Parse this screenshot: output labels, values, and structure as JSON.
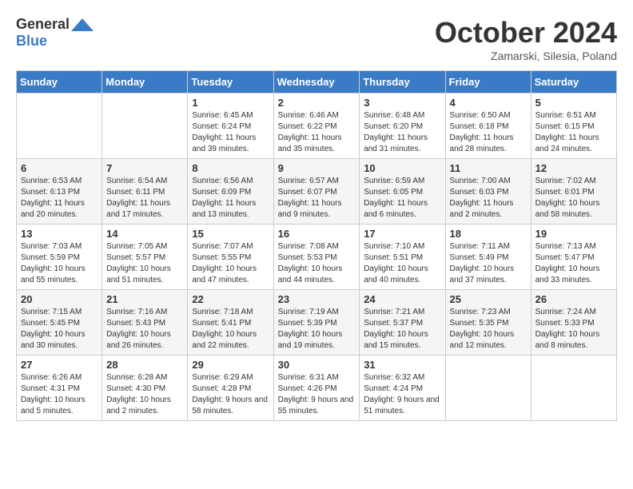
{
  "logo": {
    "general": "General",
    "blue": "Blue"
  },
  "title": "October 2024",
  "location": "Zamarski, Silesia, Poland",
  "days_of_week": [
    "Sunday",
    "Monday",
    "Tuesday",
    "Wednesday",
    "Thursday",
    "Friday",
    "Saturday"
  ],
  "weeks": [
    [
      {
        "day": "",
        "info": ""
      },
      {
        "day": "",
        "info": ""
      },
      {
        "day": "1",
        "info": "Sunrise: 6:45 AM\nSunset: 6:24 PM\nDaylight: 11 hours and 39 minutes."
      },
      {
        "day": "2",
        "info": "Sunrise: 6:46 AM\nSunset: 6:22 PM\nDaylight: 11 hours and 35 minutes."
      },
      {
        "day": "3",
        "info": "Sunrise: 6:48 AM\nSunset: 6:20 PM\nDaylight: 11 hours and 31 minutes."
      },
      {
        "day": "4",
        "info": "Sunrise: 6:50 AM\nSunset: 6:18 PM\nDaylight: 11 hours and 28 minutes."
      },
      {
        "day": "5",
        "info": "Sunrise: 6:51 AM\nSunset: 6:15 PM\nDaylight: 11 hours and 24 minutes."
      }
    ],
    [
      {
        "day": "6",
        "info": "Sunrise: 6:53 AM\nSunset: 6:13 PM\nDaylight: 11 hours and 20 minutes."
      },
      {
        "day": "7",
        "info": "Sunrise: 6:54 AM\nSunset: 6:11 PM\nDaylight: 11 hours and 17 minutes."
      },
      {
        "day": "8",
        "info": "Sunrise: 6:56 AM\nSunset: 6:09 PM\nDaylight: 11 hours and 13 minutes."
      },
      {
        "day": "9",
        "info": "Sunrise: 6:57 AM\nSunset: 6:07 PM\nDaylight: 11 hours and 9 minutes."
      },
      {
        "day": "10",
        "info": "Sunrise: 6:59 AM\nSunset: 6:05 PM\nDaylight: 11 hours and 6 minutes."
      },
      {
        "day": "11",
        "info": "Sunrise: 7:00 AM\nSunset: 6:03 PM\nDaylight: 11 hours and 2 minutes."
      },
      {
        "day": "12",
        "info": "Sunrise: 7:02 AM\nSunset: 6:01 PM\nDaylight: 10 hours and 58 minutes."
      }
    ],
    [
      {
        "day": "13",
        "info": "Sunrise: 7:03 AM\nSunset: 5:59 PM\nDaylight: 10 hours and 55 minutes."
      },
      {
        "day": "14",
        "info": "Sunrise: 7:05 AM\nSunset: 5:57 PM\nDaylight: 10 hours and 51 minutes."
      },
      {
        "day": "15",
        "info": "Sunrise: 7:07 AM\nSunset: 5:55 PM\nDaylight: 10 hours and 47 minutes."
      },
      {
        "day": "16",
        "info": "Sunrise: 7:08 AM\nSunset: 5:53 PM\nDaylight: 10 hours and 44 minutes."
      },
      {
        "day": "17",
        "info": "Sunrise: 7:10 AM\nSunset: 5:51 PM\nDaylight: 10 hours and 40 minutes."
      },
      {
        "day": "18",
        "info": "Sunrise: 7:11 AM\nSunset: 5:49 PM\nDaylight: 10 hours and 37 minutes."
      },
      {
        "day": "19",
        "info": "Sunrise: 7:13 AM\nSunset: 5:47 PM\nDaylight: 10 hours and 33 minutes."
      }
    ],
    [
      {
        "day": "20",
        "info": "Sunrise: 7:15 AM\nSunset: 5:45 PM\nDaylight: 10 hours and 30 minutes."
      },
      {
        "day": "21",
        "info": "Sunrise: 7:16 AM\nSunset: 5:43 PM\nDaylight: 10 hours and 26 minutes."
      },
      {
        "day": "22",
        "info": "Sunrise: 7:18 AM\nSunset: 5:41 PM\nDaylight: 10 hours and 22 minutes."
      },
      {
        "day": "23",
        "info": "Sunrise: 7:19 AM\nSunset: 5:39 PM\nDaylight: 10 hours and 19 minutes."
      },
      {
        "day": "24",
        "info": "Sunrise: 7:21 AM\nSunset: 5:37 PM\nDaylight: 10 hours and 15 minutes."
      },
      {
        "day": "25",
        "info": "Sunrise: 7:23 AM\nSunset: 5:35 PM\nDaylight: 10 hours and 12 minutes."
      },
      {
        "day": "26",
        "info": "Sunrise: 7:24 AM\nSunset: 5:33 PM\nDaylight: 10 hours and 8 minutes."
      }
    ],
    [
      {
        "day": "27",
        "info": "Sunrise: 6:26 AM\nSunset: 4:31 PM\nDaylight: 10 hours and 5 minutes."
      },
      {
        "day": "28",
        "info": "Sunrise: 6:28 AM\nSunset: 4:30 PM\nDaylight: 10 hours and 2 minutes."
      },
      {
        "day": "29",
        "info": "Sunrise: 6:29 AM\nSunset: 4:28 PM\nDaylight: 9 hours and 58 minutes."
      },
      {
        "day": "30",
        "info": "Sunrise: 6:31 AM\nSunset: 4:26 PM\nDaylight: 9 hours and 55 minutes."
      },
      {
        "day": "31",
        "info": "Sunrise: 6:32 AM\nSunset: 4:24 PM\nDaylight: 9 hours and 51 minutes."
      },
      {
        "day": "",
        "info": ""
      },
      {
        "day": "",
        "info": ""
      }
    ]
  ]
}
